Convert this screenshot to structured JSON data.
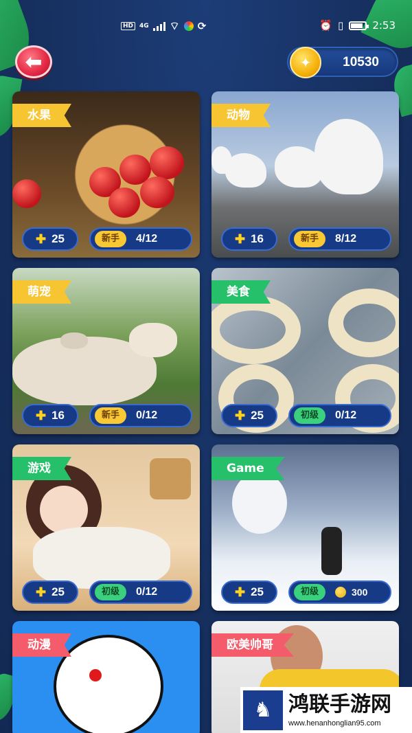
{
  "status_bar": {
    "hd": "HD",
    "network": "4G",
    "time": "2:53"
  },
  "header": {
    "back_icon": "arrow-left-icon",
    "coins": "10530"
  },
  "categories": [
    {
      "label": "水果",
      "tag_color": "#f7c531",
      "pieces": "25",
      "level": "新手",
      "level_color": "#f8c934",
      "progress": "4/12"
    },
    {
      "label": "动物",
      "tag_color": "#f7c531",
      "pieces": "16",
      "level": "新手",
      "level_color": "#f8c934",
      "progress": "8/12"
    },
    {
      "label": "萌宠",
      "tag_color": "#f7c531",
      "pieces": "16",
      "level": "新手",
      "level_color": "#f8c934",
      "progress": "0/12"
    },
    {
      "label": "美食",
      "tag_color": "#26c06a",
      "pieces": "25",
      "level": "初级",
      "level_color": "#3ad07d",
      "progress": "0/12"
    },
    {
      "label": "游戏",
      "tag_color": "#26c06a",
      "pieces": "25",
      "level": "初级",
      "level_color": "#3ad07d",
      "progress": "0/12"
    },
    {
      "label": "Game",
      "tag_color": "#26c06a",
      "pieces": "25",
      "level": "初级",
      "level_color": "#3ad07d",
      "progress": "300"
    },
    {
      "label": "动漫",
      "tag_color": "#f45c6b"
    },
    {
      "label": "欧美帅哥",
      "tag_color": "#f45c6b"
    }
  ],
  "watermark": {
    "title": "鸿联手游网",
    "url": "www.henanhonglian95.com"
  }
}
